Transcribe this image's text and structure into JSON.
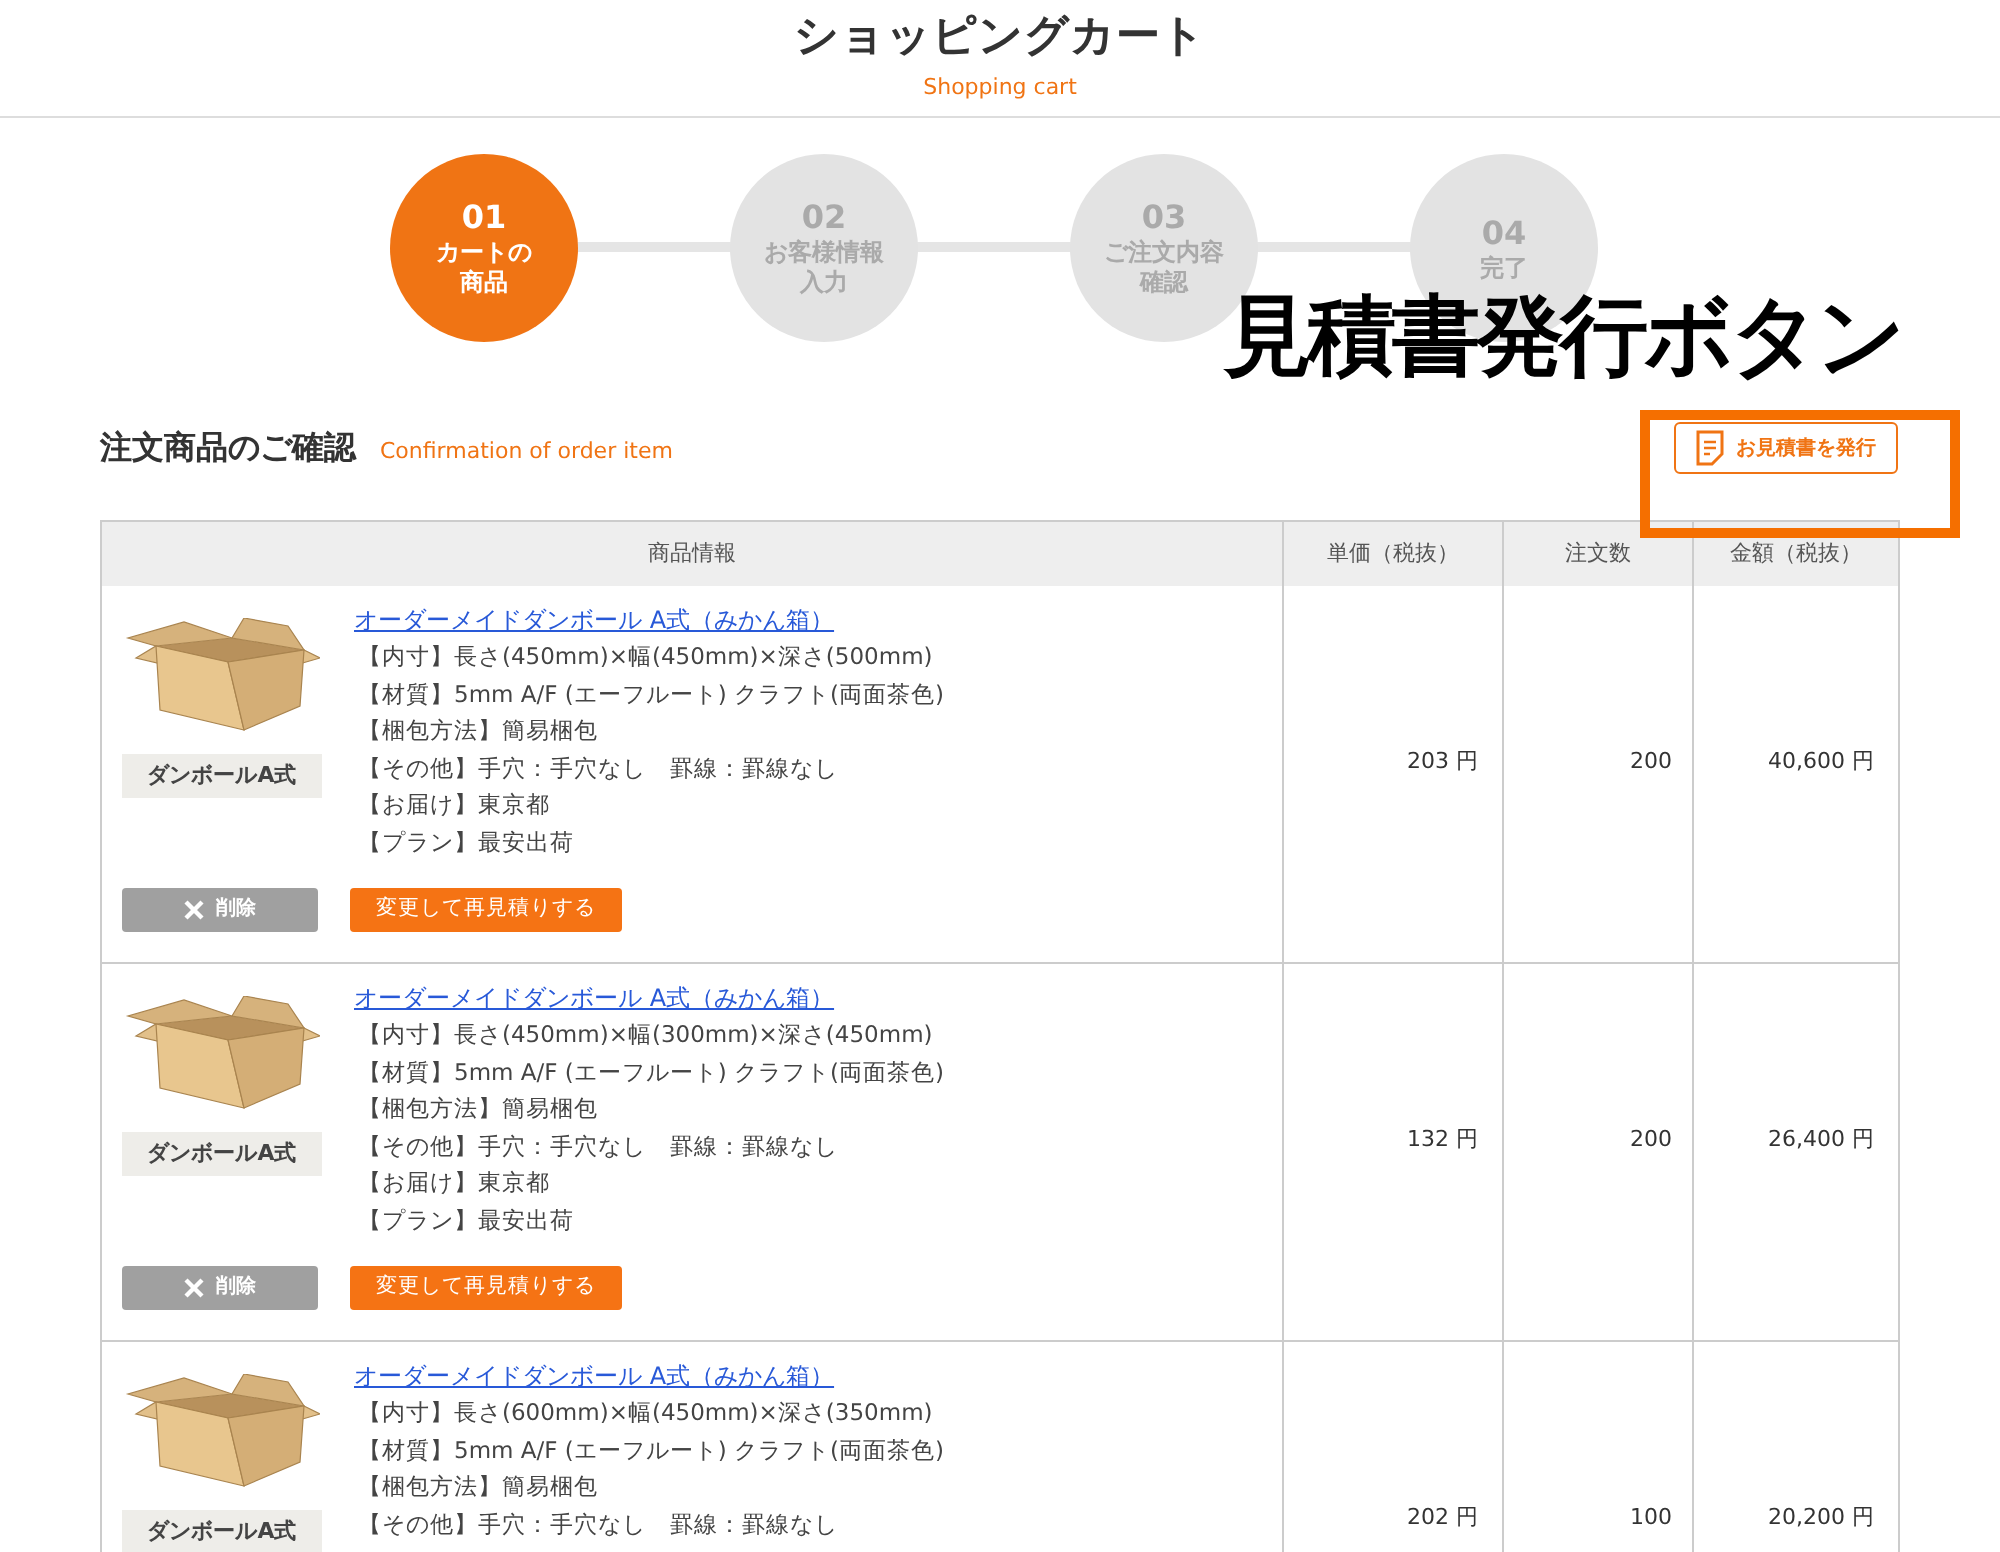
{
  "header": {
    "title": "ショッピングカート",
    "subtitle": "Shopping cart"
  },
  "steps": [
    {
      "number": "01",
      "label_lines": [
        "カートの",
        "商品"
      ],
      "selected": true
    },
    {
      "number": "02",
      "label_lines": [
        "お客様情報",
        "入力"
      ],
      "selected": false
    },
    {
      "number": "03",
      "label_lines": [
        "ご注文内容",
        "確認"
      ],
      "selected": false
    },
    {
      "number": "04",
      "label_lines": [
        "完了"
      ],
      "selected": false
    }
  ],
  "annotation": {
    "text": "見積書発行ボタン"
  },
  "section": {
    "title": "注文商品のご確認",
    "subtitle": "Confirmation of order item",
    "quote_button": "お見積書を発行"
  },
  "table": {
    "columns": [
      "商品情報",
      "単価（税抜）",
      "注文数",
      "金額（税抜）"
    ],
    "rows": [
      {
        "image_label": "ダンボールA式",
        "name": "オーダーメイドダンボール A式（みかん箱）",
        "details": [
          "【内寸】長さ(450mm)×幅(450mm)×深さ(500mm)",
          "【材質】5mm A/F (エーフルート) クラフト(両面茶色)",
          "【梱包方法】簡易梱包",
          "【その他】手穴：手穴なし　罫線：罫線なし",
          "【お届け】東京都",
          "【プラン】最安出荷"
        ],
        "delete": "削除",
        "requote": "変更して再見積りする",
        "price": "203 円",
        "qty": "200",
        "amount": "40,600 円"
      },
      {
        "image_label": "ダンボールA式",
        "name": "オーダーメイドダンボール A式（みかん箱）",
        "details": [
          "【内寸】長さ(450mm)×幅(300mm)×深さ(450mm)",
          "【材質】5mm A/F (エーフルート) クラフト(両面茶色)",
          "【梱包方法】簡易梱包",
          "【その他】手穴：手穴なし　罫線：罫線なし",
          "【お届け】東京都",
          "【プラン】最安出荷"
        ],
        "delete": "削除",
        "requote": "変更して再見積りする",
        "price": "132 円",
        "qty": "200",
        "amount": "26,400 円"
      },
      {
        "image_label": "ダンボールA式",
        "name": "オーダーメイドダンボール A式（みかん箱）",
        "details": [
          "【内寸】長さ(600mm)×幅(450mm)×深さ(350mm)",
          "【材質】5mm A/F (エーフルート) クラフト(両面茶色)",
          "【梱包方法】簡易梱包",
          "【その他】手穴：手穴なし　罫線：罫線なし"
        ],
        "price": "202 円",
        "qty": "100",
        "amount": "20,200 円"
      }
    ]
  }
}
